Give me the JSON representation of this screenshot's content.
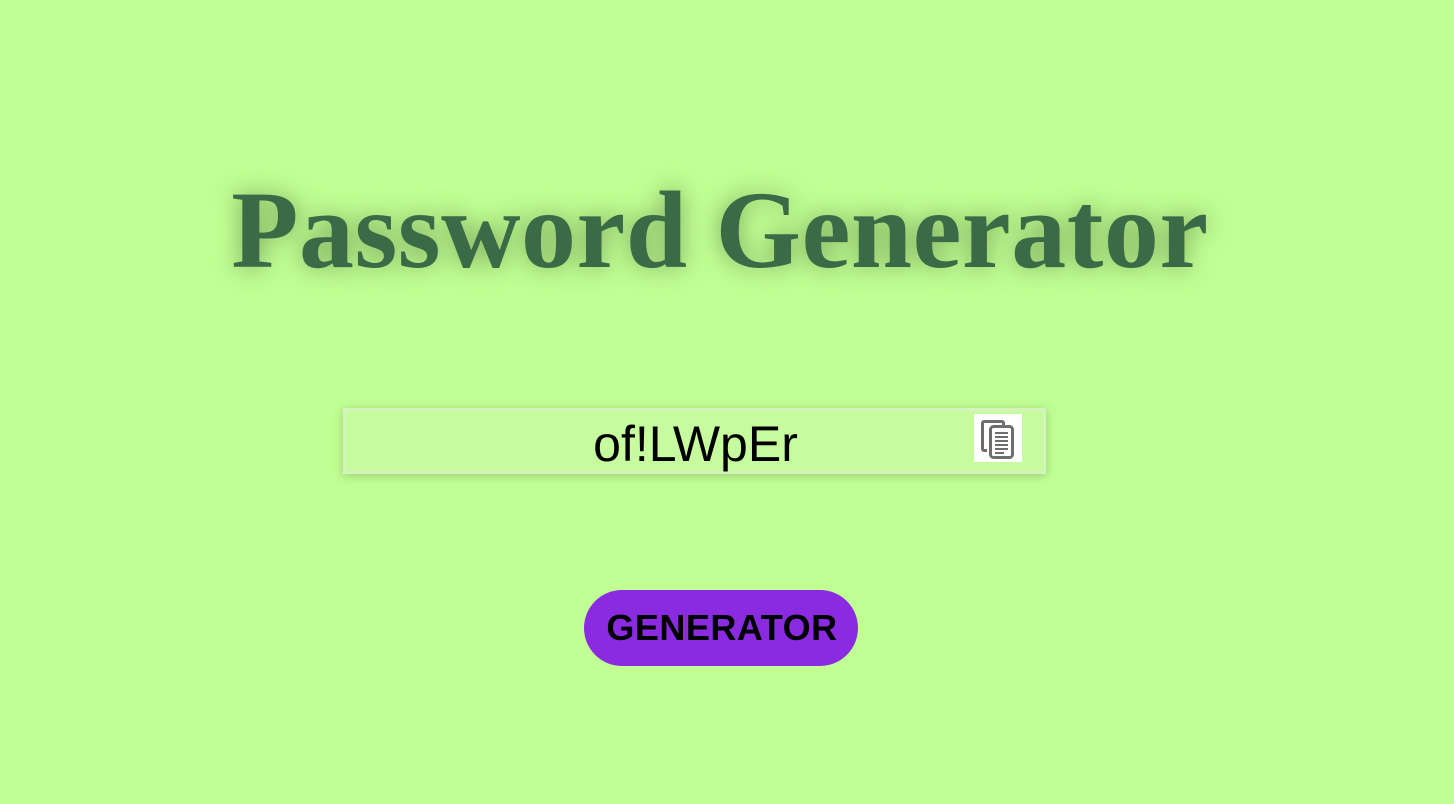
{
  "header": {
    "title": "Password Generator"
  },
  "password": {
    "value": "of!LWpEr",
    "copy_icon": "copy-icon"
  },
  "actions": {
    "generate_label": "GENERATOR"
  },
  "colors": {
    "background": "#c1ff94",
    "title": "#3b6a46",
    "button": "#8a2be2"
  }
}
